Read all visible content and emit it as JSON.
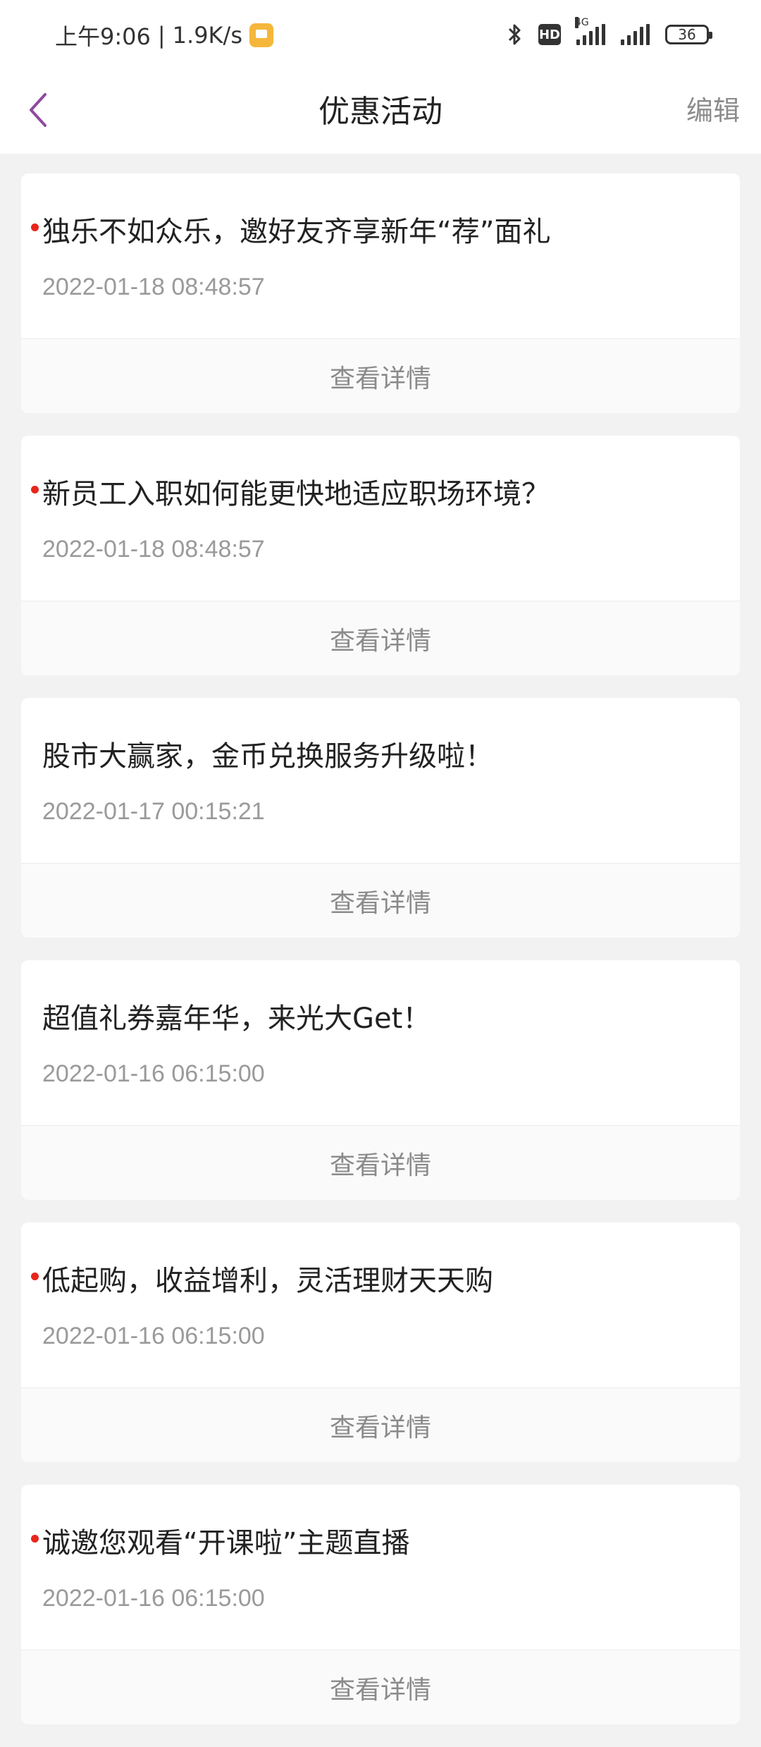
{
  "status_bar": {
    "time": "上午9:06",
    "net_speed": "1.9K/s",
    "hd": "HD",
    "network": "4G",
    "battery": "36"
  },
  "header": {
    "title": "优惠活动",
    "edit_label": "编辑"
  },
  "cards": [
    {
      "title": "独乐不如众乐，邀好友齐享新年“荐”面礼",
      "time": "2022-01-18 08:48:57",
      "unread": true,
      "action": "查看详情"
    },
    {
      "title": "新员工入职如何能更快地适应职场环境？",
      "time": "2022-01-18 08:48:57",
      "unread": true,
      "action": "查看详情"
    },
    {
      "title": "股市大赢家，金币兑换服务升级啦！",
      "time": "2022-01-17 00:15:21",
      "unread": false,
      "action": "查看详情"
    },
    {
      "title": "超值礼券嘉年华，来光大Get！",
      "time": "2022-01-16 06:15:00",
      "unread": false,
      "action": "查看详情"
    },
    {
      "title": "低起购，收益增利，灵活理财天天购",
      "time": "2022-01-16 06:15:00",
      "unread": true,
      "action": "查看详情"
    },
    {
      "title": "诚邀您观看“开课啦”主题直播",
      "time": "2022-01-16 06:15:00",
      "unread": true,
      "action": "查看详情"
    }
  ],
  "colors": {
    "accent": "#8e4a9e",
    "unread": "#e8261b",
    "background": "#f2f2f2"
  }
}
